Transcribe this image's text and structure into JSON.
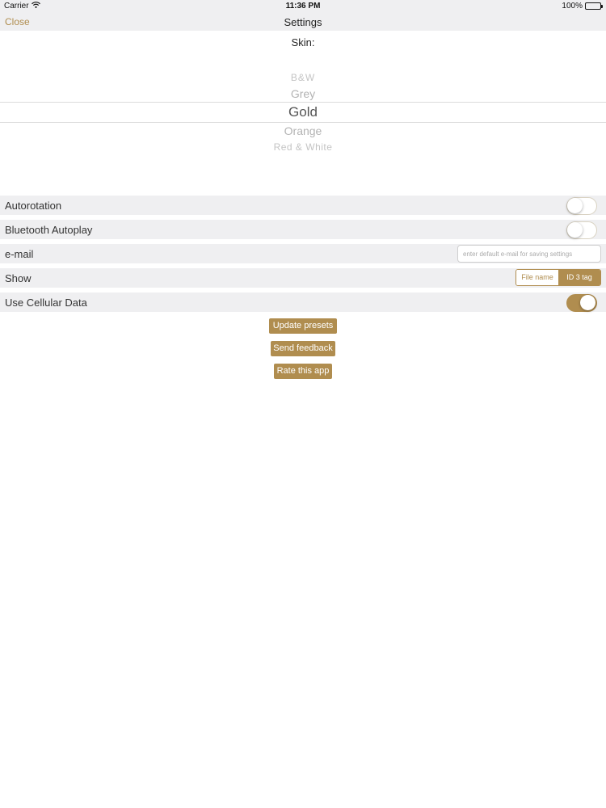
{
  "status_bar": {
    "carrier": "Carrier",
    "time": "11:36 PM",
    "battery": "100%"
  },
  "nav": {
    "close_label": "Close",
    "title": "Settings"
  },
  "skin": {
    "label": "Skin:",
    "options": [
      "B&W",
      "Grey",
      "Gold",
      "Orange",
      "Red & White"
    ],
    "selected": "Gold"
  },
  "settings": {
    "autorotation": {
      "label": "Autorotation",
      "on": false
    },
    "bluetooth_autoplay": {
      "label": "Bluetooth Autoplay",
      "on": false
    },
    "email": {
      "label": "e-mail",
      "value": "",
      "placeholder": "enter default e-mail for saving settings"
    },
    "show": {
      "label": "Show",
      "segments": [
        "File name",
        "ID 3 tag"
      ],
      "selected": "ID 3 tag"
    },
    "use_cellular_data": {
      "label": "Use Cellular Data",
      "on": true
    }
  },
  "buttons": {
    "update_presets": "Update presets",
    "send_feedback": "Send feedback",
    "rate_app": "Rate this app"
  },
  "colors": {
    "accent": "#b08d4f",
    "row_bg": "#efeff1"
  }
}
